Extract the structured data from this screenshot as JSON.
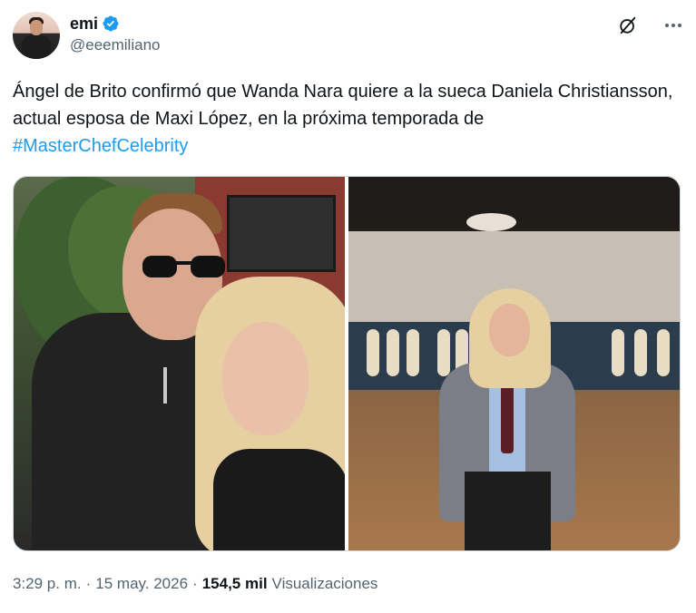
{
  "author": {
    "display_name": "emi",
    "handle": "@eeemiliano",
    "verified": true,
    "verified_color": "#1d9bf0"
  },
  "tweet": {
    "text": "Ángel de Brito confirmó que Wanda Nara quiere a la sueca Daniela Christiansson, actual esposa de Maxi López, en la próxima temporada de",
    "hashtag": "#MasterChefCelebrity",
    "hashtag_color": "#1d9bf0"
  },
  "media": {
    "photos": [
      {
        "name": "couple-selfie-photo"
      },
      {
        "name": "masterchef-set-photo"
      }
    ]
  },
  "meta": {
    "time": "3:29 p. m.",
    "separator": "·",
    "date": "15 may. 2026",
    "views_count": "154,5 mil",
    "views_label": "Visualizaciones"
  },
  "icons": {
    "verified": "verified-badge-icon",
    "grok": "grok-icon",
    "more": "more-icon"
  }
}
